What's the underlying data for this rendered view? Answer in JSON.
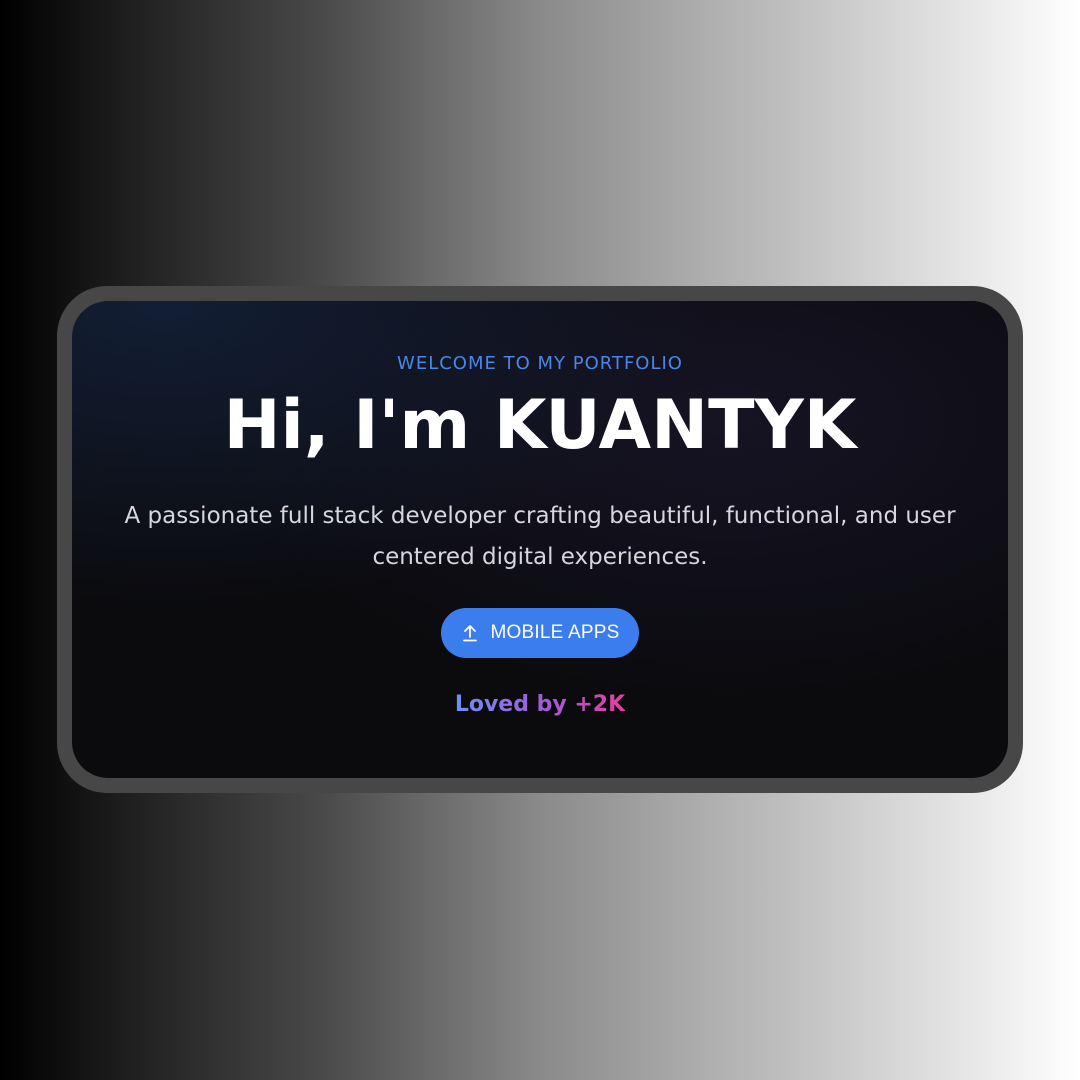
{
  "hero": {
    "eyebrow": "WELCOME TO MY PORTFOLIO",
    "headline": "Hi, I'm KUANTYK",
    "subtitle": "A passionate full stack developer crafting beautiful, functional, and user centered digital experiences.",
    "cta_label": "MOBILE APPS",
    "cta_icon": "upload-arrow-icon",
    "social_proof": "Loved by +2K"
  },
  "colors": {
    "accent": "#3b7ded",
    "eyebrow": "#4a86e8",
    "gradient_start": "#6f8ef5",
    "gradient_end": "#e3409e",
    "screen_bg": "#0b0b0e",
    "device_frame": "#474747"
  }
}
